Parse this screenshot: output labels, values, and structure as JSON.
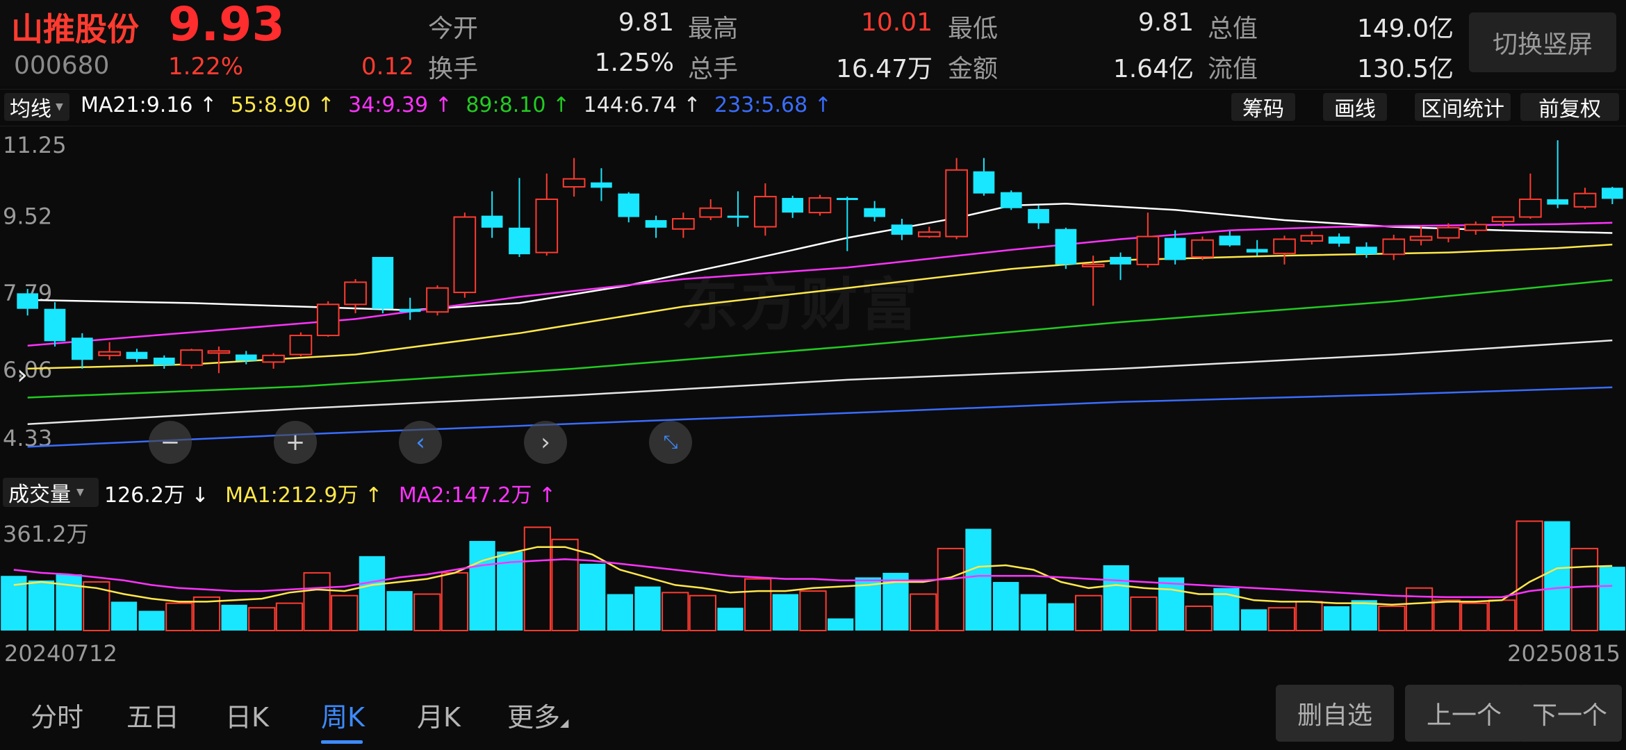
{
  "header": {
    "name": "山推股份",
    "price": "9.93",
    "code": "000680",
    "change_pct": "1.22%",
    "change_amt": "0.12",
    "quotes": [
      {
        "label": "今开",
        "value": "9.81",
        "red": false
      },
      {
        "label": "最高",
        "value": "10.01",
        "red": true
      },
      {
        "label": "最低",
        "value": "9.81",
        "red": false
      },
      {
        "label": "总值",
        "value": "149.0亿",
        "red": false
      },
      {
        "label": "换手",
        "value": "1.25%",
        "red": false
      },
      {
        "label": "总手",
        "value": "16.47万",
        "red": false
      },
      {
        "label": "金额",
        "value": "1.64亿",
        "red": false
      },
      {
        "label": "流值",
        "value": "130.5亿",
        "red": false
      }
    ],
    "switch_label": "切换竖屏"
  },
  "ma_bar": {
    "selector": "均线",
    "items": [
      {
        "text": "MA21:9.16 ↑",
        "color": "#ffffff"
      },
      {
        "text": "55:8.90 ↑",
        "color": "#ffe84a"
      },
      {
        "text": "34:9.39 ↑",
        "color": "#ff33ff"
      },
      {
        "text": "89:8.10 ↑",
        "color": "#22cc22"
      },
      {
        "text": "144:6.74 ↑",
        "color": "#e6e6e6"
      },
      {
        "text": "233:5.68 ↑",
        "color": "#3a6dff"
      }
    ],
    "tools": [
      "筹码",
      "画线",
      "区间统计",
      "前复权"
    ]
  },
  "price_axis": [
    "11.25",
    "9.52",
    "7.79",
    "6.06",
    "4.33"
  ],
  "volume_bar": {
    "selector": "成交量",
    "items": [
      {
        "text": "126.2万 ↓",
        "color": "#ffffff"
      },
      {
        "text": "MA1:212.9万 ↑",
        "color": "#ffe84a"
      },
      {
        "text": "MA2:147.2万 ↑",
        "color": "#ff33ff"
      }
    ],
    "max_label": "361.2万"
  },
  "dates": {
    "start": "20240712",
    "end": "20250815"
  },
  "watermark": "东方财富",
  "tabs": [
    {
      "label": "分时",
      "active": false
    },
    {
      "label": "五日",
      "active": false
    },
    {
      "label": "日K",
      "active": false
    },
    {
      "label": "周K",
      "active": true
    },
    {
      "label": "月K",
      "active": false
    },
    {
      "label": "更多",
      "active": false
    }
  ],
  "actions": [
    "删自选",
    "上一个",
    "下一个"
  ],
  "colors": {
    "up": "#ff3b30",
    "down": "#19e6ff",
    "accent": "#3d8bff"
  },
  "chart_data": {
    "type": "candlestick",
    "ylim": [
      4.33,
      11.25
    ],
    "candles": [
      {
        "o": 7.8,
        "c": 7.45,
        "h": 7.9,
        "l": 7.3,
        "up": false
      },
      {
        "o": 7.45,
        "c": 6.72,
        "h": 7.6,
        "l": 6.6,
        "up": false
      },
      {
        "o": 6.8,
        "c": 6.3,
        "h": 6.9,
        "l": 6.1,
        "up": false
      },
      {
        "o": 6.4,
        "c": 6.48,
        "h": 6.7,
        "l": 6.3,
        "up": true
      },
      {
        "o": 6.48,
        "c": 6.32,
        "h": 6.55,
        "l": 6.25,
        "up": false
      },
      {
        "o": 6.35,
        "c": 6.18,
        "h": 6.4,
        "l": 6.1,
        "up": false
      },
      {
        "o": 6.18,
        "c": 6.52,
        "h": 6.55,
        "l": 6.1,
        "up": true
      },
      {
        "o": 6.5,
        "c": 6.48,
        "h": 6.6,
        "l": 6.0,
        "up": true
      },
      {
        "o": 6.42,
        "c": 6.28,
        "h": 6.5,
        "l": 6.2,
        "up": false
      },
      {
        "o": 6.25,
        "c": 6.4,
        "h": 6.45,
        "l": 6.1,
        "up": true
      },
      {
        "o": 6.42,
        "c": 6.85,
        "h": 6.92,
        "l": 6.38,
        "up": true
      },
      {
        "o": 6.85,
        "c": 7.55,
        "h": 7.62,
        "l": 6.82,
        "up": true
      },
      {
        "o": 7.55,
        "c": 8.05,
        "h": 8.12,
        "l": 7.35,
        "up": true
      },
      {
        "o": 8.62,
        "c": 7.45,
        "h": 8.62,
        "l": 7.35,
        "up": false
      },
      {
        "o": 7.45,
        "c": 7.38,
        "h": 7.7,
        "l": 7.2,
        "up": false
      },
      {
        "o": 7.38,
        "c": 7.92,
        "h": 7.98,
        "l": 7.3,
        "up": true
      },
      {
        "o": 7.82,
        "c": 9.52,
        "h": 9.62,
        "l": 7.7,
        "up": true
      },
      {
        "o": 9.55,
        "c": 9.28,
        "h": 10.1,
        "l": 9.05,
        "up": false
      },
      {
        "o": 9.28,
        "c": 8.68,
        "h": 10.4,
        "l": 8.62,
        "up": false
      },
      {
        "o": 8.72,
        "c": 9.92,
        "h": 10.5,
        "l": 8.65,
        "up": true
      },
      {
        "o": 10.2,
        "c": 10.38,
        "h": 10.85,
        "l": 9.98,
        "up": true
      },
      {
        "o": 10.3,
        "c": 10.18,
        "h": 10.62,
        "l": 9.88,
        "up": false
      },
      {
        "o": 10.05,
        "c": 9.52,
        "h": 10.08,
        "l": 9.4,
        "up": false
      },
      {
        "o": 9.45,
        "c": 9.28,
        "h": 9.55,
        "l": 9.05,
        "up": false
      },
      {
        "o": 9.25,
        "c": 9.48,
        "h": 9.62,
        "l": 9.05,
        "up": true
      },
      {
        "o": 9.52,
        "c": 9.72,
        "h": 9.92,
        "l": 9.45,
        "up": true
      },
      {
        "o": 9.55,
        "c": 9.55,
        "h": 10.1,
        "l": 9.3,
        "up": false
      },
      {
        "o": 9.3,
        "c": 9.98,
        "h": 10.28,
        "l": 9.1,
        "up": true
      },
      {
        "o": 9.95,
        "c": 9.62,
        "h": 10.0,
        "l": 9.5,
        "up": false
      },
      {
        "o": 9.62,
        "c": 9.95,
        "h": 10.02,
        "l": 9.55,
        "up": true
      },
      {
        "o": 9.95,
        "c": 9.92,
        "h": 9.98,
        "l": 8.75,
        "up": false
      },
      {
        "o": 9.72,
        "c": 9.52,
        "h": 9.88,
        "l": 9.42,
        "up": false
      },
      {
        "o": 9.35,
        "c": 9.12,
        "h": 9.48,
        "l": 9.0,
        "up": false
      },
      {
        "o": 9.08,
        "c": 9.18,
        "h": 9.3,
        "l": 9.05,
        "up": true
      },
      {
        "o": 9.08,
        "c": 10.58,
        "h": 10.85,
        "l": 9.02,
        "up": true
      },
      {
        "o": 10.55,
        "c": 10.05,
        "h": 10.85,
        "l": 10.0,
        "up": false
      },
      {
        "o": 10.08,
        "c": 9.72,
        "h": 10.12,
        "l": 9.68,
        "up": false
      },
      {
        "o": 9.7,
        "c": 9.38,
        "h": 9.78,
        "l": 9.25,
        "up": false
      },
      {
        "o": 9.25,
        "c": 8.45,
        "h": 9.28,
        "l": 8.35,
        "up": false
      },
      {
        "o": 8.42,
        "c": 8.45,
        "h": 8.65,
        "l": 7.52,
        "up": true
      },
      {
        "o": 8.62,
        "c": 8.45,
        "h": 8.72,
        "l": 8.1,
        "up": false
      },
      {
        "o": 8.45,
        "c": 9.08,
        "h": 9.62,
        "l": 8.38,
        "up": true
      },
      {
        "o": 9.05,
        "c": 8.55,
        "h": 9.22,
        "l": 8.45,
        "up": false
      },
      {
        "o": 8.62,
        "c": 9.0,
        "h": 9.08,
        "l": 8.55,
        "up": true
      },
      {
        "o": 9.1,
        "c": 8.88,
        "h": 9.2,
        "l": 8.85,
        "up": false
      },
      {
        "o": 8.8,
        "c": 8.72,
        "h": 9.0,
        "l": 8.65,
        "up": false
      },
      {
        "o": 8.7,
        "c": 9.02,
        "h": 9.1,
        "l": 8.45,
        "up": true
      },
      {
        "o": 8.98,
        "c": 9.1,
        "h": 9.2,
        "l": 8.9,
        "up": true
      },
      {
        "o": 9.08,
        "c": 8.92,
        "h": 9.15,
        "l": 8.85,
        "up": false
      },
      {
        "o": 8.85,
        "c": 8.68,
        "h": 8.95,
        "l": 8.6,
        "up": false
      },
      {
        "o": 8.68,
        "c": 9.02,
        "h": 9.12,
        "l": 8.55,
        "up": true
      },
      {
        "o": 9.0,
        "c": 9.08,
        "h": 9.32,
        "l": 8.88,
        "up": true
      },
      {
        "o": 9.05,
        "c": 9.28,
        "h": 9.38,
        "l": 8.95,
        "up": true
      },
      {
        "o": 9.22,
        "c": 9.35,
        "h": 9.42,
        "l": 9.12,
        "up": true
      },
      {
        "o": 9.42,
        "c": 9.52,
        "h": 9.52,
        "l": 9.3,
        "up": true
      },
      {
        "o": 9.52,
        "c": 9.92,
        "h": 10.5,
        "l": 9.48,
        "up": true
      },
      {
        "o": 9.92,
        "c": 9.8,
        "h": 11.25,
        "l": 9.72,
        "up": false
      },
      {
        "o": 9.75,
        "c": 10.05,
        "h": 10.18,
        "l": 9.7,
        "up": true
      },
      {
        "o": 10.18,
        "c": 9.93,
        "h": 10.2,
        "l": 9.81,
        "up": false
      }
    ],
    "ma_lines": [
      {
        "name": "MA21",
        "color": "#ffffff",
        "points": [
          [
            0,
            7.65
          ],
          [
            6,
            7.58
          ],
          [
            11,
            7.48
          ],
          [
            14,
            7.42
          ],
          [
            18,
            7.58
          ],
          [
            22,
            7.98
          ],
          [
            26,
            8.5
          ],
          [
            30,
            9.05
          ],
          [
            34,
            9.5
          ],
          [
            36,
            9.78
          ],
          [
            38,
            9.82
          ],
          [
            42,
            9.68
          ],
          [
            46,
            9.45
          ],
          [
            50,
            9.3
          ],
          [
            54,
            9.22
          ],
          [
            58,
            9.16
          ]
        ]
      },
      {
        "name": "55",
        "color": "#ffe84a",
        "points": [
          [
            0,
            6.1
          ],
          [
            6,
            6.2
          ],
          [
            12,
            6.42
          ],
          [
            18,
            6.9
          ],
          [
            24,
            7.5
          ],
          [
            30,
            7.92
          ],
          [
            36,
            8.35
          ],
          [
            40,
            8.55
          ],
          [
            46,
            8.65
          ],
          [
            52,
            8.72
          ],
          [
            56,
            8.82
          ],
          [
            58,
            8.9
          ]
        ]
      },
      {
        "name": "34",
        "color": "#ff33ff",
        "points": [
          [
            0,
            6.62
          ],
          [
            6,
            6.92
          ],
          [
            12,
            7.22
          ],
          [
            18,
            7.72
          ],
          [
            24,
            8.12
          ],
          [
            30,
            8.38
          ],
          [
            36,
            8.78
          ],
          [
            40,
            9.02
          ],
          [
            44,
            9.22
          ],
          [
            48,
            9.3
          ],
          [
            52,
            9.33
          ],
          [
            56,
            9.36
          ],
          [
            58,
            9.39
          ]
        ]
      },
      {
        "name": "89",
        "color": "#22cc22",
        "points": [
          [
            0,
            5.45
          ],
          [
            10,
            5.7
          ],
          [
            20,
            6.1
          ],
          [
            30,
            6.6
          ],
          [
            40,
            7.15
          ],
          [
            50,
            7.62
          ],
          [
            58,
            8.1
          ]
        ]
      },
      {
        "name": "144",
        "color": "#e6e6e6",
        "points": [
          [
            0,
            4.85
          ],
          [
            10,
            5.2
          ],
          [
            20,
            5.5
          ],
          [
            30,
            5.85
          ],
          [
            40,
            6.1
          ],
          [
            50,
            6.42
          ],
          [
            58,
            6.74
          ]
        ]
      },
      {
        "name": "233",
        "color": "#3a6dff",
        "points": [
          [
            0,
            4.34
          ],
          [
            10,
            4.62
          ],
          [
            20,
            4.86
          ],
          [
            30,
            5.1
          ],
          [
            40,
            5.35
          ],
          [
            50,
            5.52
          ],
          [
            58,
            5.68
          ]
        ]
      }
    ],
    "volume": {
      "max": 361.2,
      "values": [
        180,
        165,
        185,
        160,
        95,
        65,
        90,
        110,
        85,
        75,
        90,
        190,
        115,
        245,
        130,
        120,
        190,
        295,
        260,
        340,
        300,
        220,
        120,
        145,
        125,
        115,
        75,
        170,
        120,
        130,
        40,
        175,
        190,
        120,
        270,
        335,
        160,
        120,
        90,
        115,
        215,
        110,
        175,
        80,
        140,
        70,
        75,
        95,
        80,
        100,
        80,
        140,
        100,
        90,
        100,
        360,
        360,
        270,
        210
      ],
      "up": [
        false,
        false,
        false,
        true,
        false,
        false,
        true,
        true,
        false,
        true,
        true,
        true,
        true,
        false,
        false,
        true,
        true,
        false,
        false,
        true,
        true,
        false,
        false,
        false,
        true,
        true,
        false,
        true,
        false,
        true,
        false,
        false,
        false,
        true,
        true,
        false,
        false,
        false,
        false,
        true,
        false,
        true,
        false,
        true,
        false,
        false,
        true,
        true,
        false,
        false,
        true,
        true,
        true,
        true,
        true,
        true,
        false,
        true,
        false
      ],
      "ma1": [
        150,
        160,
        150,
        140,
        120,
        105,
        95,
        95,
        100,
        105,
        125,
        135,
        130,
        150,
        160,
        170,
        190,
        230,
        255,
        275,
        275,
        250,
        200,
        175,
        150,
        140,
        125,
        130,
        130,
        140,
        145,
        150,
        160,
        160,
        175,
        210,
        215,
        200,
        160,
        140,
        150,
        140,
        135,
        120,
        120,
        100,
        95,
        95,
        90,
        90,
        85,
        90,
        95,
        95,
        100,
        160,
        205,
        210,
        212.9
      ],
      "ma2": [
        200,
        190,
        185,
        175,
        165,
        150,
        140,
        135,
        130,
        130,
        135,
        140,
        145,
        160,
        175,
        185,
        200,
        215,
        225,
        230,
        235,
        230,
        220,
        210,
        200,
        190,
        180,
        175,
        170,
        170,
        165,
        165,
        165,
        165,
        170,
        180,
        180,
        180,
        175,
        170,
        165,
        160,
        155,
        150,
        145,
        140,
        135,
        130,
        125,
        120,
        115,
        112,
        110,
        110,
        110,
        130,
        140,
        145,
        147.2
      ]
    }
  }
}
